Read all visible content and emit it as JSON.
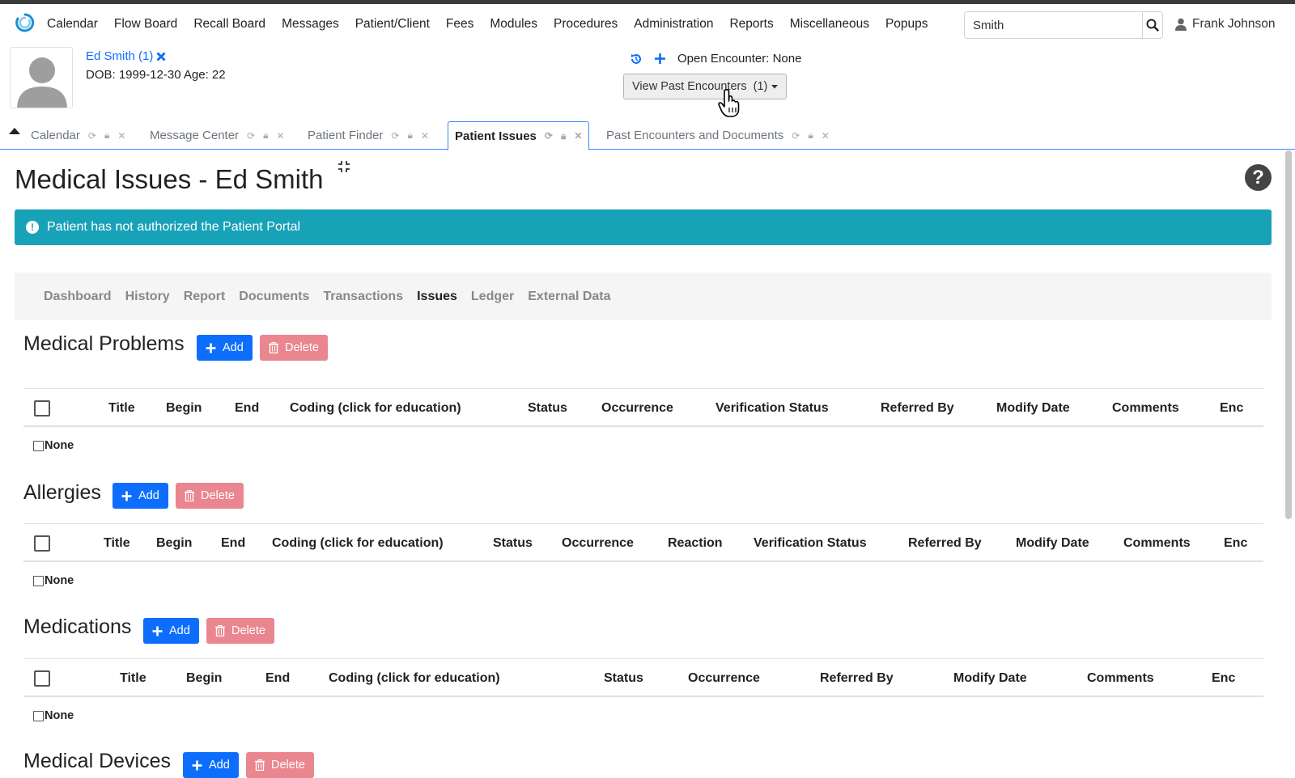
{
  "top_menu": [
    "Calendar",
    "Flow Board",
    "Recall Board",
    "Messages",
    "Patient/Client",
    "Fees",
    "Modules",
    "Procedures",
    "Administration",
    "Reports",
    "Miscellaneous",
    "Popups"
  ],
  "search": {
    "value": "Smith"
  },
  "user": {
    "name": "Frank Johnson"
  },
  "patient": {
    "name": "Ed Smith (1)",
    "dob_line": "DOB: 1999-12-30 Age: 22"
  },
  "encounter": {
    "open_label": "Open Encounter: None",
    "past_button": "View Past Encounters  (1)"
  },
  "tabs": [
    {
      "label": "Calendar",
      "active": false
    },
    {
      "label": "Message Center",
      "active": false
    },
    {
      "label": "Patient Finder",
      "active": false
    },
    {
      "label": "Patient Issues",
      "active": true
    },
    {
      "label": "Past Encounters and Documents",
      "active": false
    }
  ],
  "page_title": "Medical Issues - Ed Smith",
  "alert": "Patient has not authorized the Patient Portal",
  "subnav": [
    {
      "label": "Dashboard",
      "current": false
    },
    {
      "label": "History",
      "current": false
    },
    {
      "label": "Report",
      "current": false
    },
    {
      "label": "Documents",
      "current": false
    },
    {
      "label": "Transactions",
      "current": false
    },
    {
      "label": "Issues",
      "current": true
    },
    {
      "label": "Ledger",
      "current": false
    },
    {
      "label": "External Data",
      "current": false
    }
  ],
  "buttons": {
    "add": "Add",
    "delete": "Delete"
  },
  "none_label": "None",
  "sections": [
    {
      "title": "Medical Problems",
      "columns": [
        "Title",
        "Begin",
        "End",
        "Coding (click for education)",
        "Status",
        "Occurrence",
        "Verification Status",
        "Referred By",
        "Modify Date",
        "Comments",
        "Enc"
      ]
    },
    {
      "title": "Allergies",
      "columns": [
        "Title",
        "Begin",
        "End",
        "Coding (click for education)",
        "Status",
        "Occurrence",
        "Reaction",
        "Verification Status",
        "Referred By",
        "Modify Date",
        "Comments",
        "Enc"
      ]
    },
    {
      "title": "Medications",
      "columns": [
        "Title",
        "Begin",
        "End",
        "Coding (click for education)",
        "Status",
        "Occurrence",
        "Referred By",
        "Modify Date",
        "Comments",
        "Enc"
      ]
    },
    {
      "title": "Medical Devices"
    }
  ],
  "colors": {
    "primary": "#0d6efd",
    "danger_light": "#ea868f",
    "info": "#17a2b8",
    "tab_accent": "#3a86ff"
  }
}
